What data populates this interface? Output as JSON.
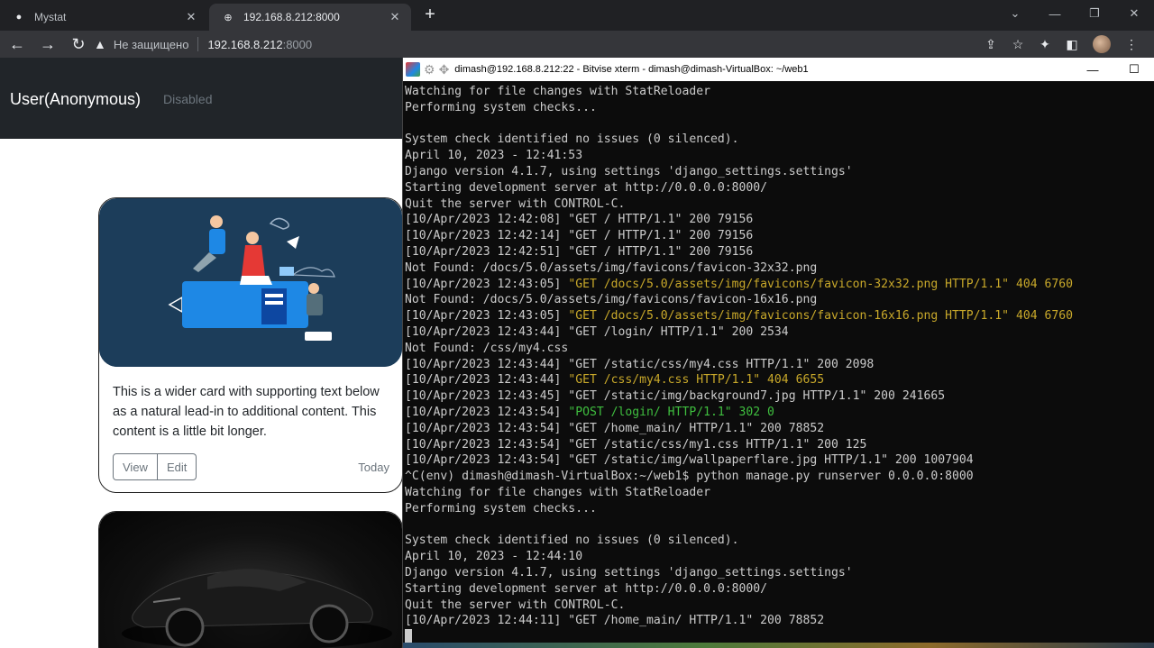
{
  "browser": {
    "tabs": [
      {
        "title": "Mystat",
        "active": false
      },
      {
        "title": "192.168.8.212:8000",
        "active": true
      }
    ],
    "address": {
      "security_label": "Не защищено",
      "host": "192.168.8.212",
      "port": ":8000"
    }
  },
  "page": {
    "brand": "User(Anonymous)",
    "nav_disabled": "Disabled",
    "cards": [
      {
        "text": "This is a wider card with supporting text below as a natural lead-in to additional content. This content is a little bit longer.",
        "buttons": [
          "View",
          "Edit"
        ],
        "meta": "Today"
      }
    ]
  },
  "terminal": {
    "title": "dimash@192.168.8.212:22 - Bitvise xterm - dimash@dimash-VirtualBox: ~/web1",
    "lines": [
      {
        "t": "Watching for file changes with StatReloader"
      },
      {
        "t": "Performing system checks..."
      },
      {
        "t": ""
      },
      {
        "t": "System check identified no issues (0 silenced)."
      },
      {
        "t": "April 10, 2023 - 12:41:53"
      },
      {
        "t": "Django version 4.1.7, using settings 'django_settings.settings'"
      },
      {
        "t": "Starting development server at http://0.0.0.0:8000/"
      },
      {
        "t": "Quit the server with CONTROL-C."
      },
      {
        "t": "[10/Apr/2023 12:42:08] \"GET / HTTP/1.1\" 200 79156"
      },
      {
        "t": "[10/Apr/2023 12:42:14] \"GET / HTTP/1.1\" 200 79156"
      },
      {
        "t": "[10/Apr/2023 12:42:51] \"GET / HTTP/1.1\" 200 79156"
      },
      {
        "t": "Not Found: /docs/5.0/assets/img/favicons/favicon-32x32.png"
      },
      {
        "p": "[10/Apr/2023 12:43:05] ",
        "t": "\"GET /docs/5.0/assets/img/favicons/favicon-32x32.png HTTP/1.1\" 404 6760",
        "c": "y"
      },
      {
        "t": "Not Found: /docs/5.0/assets/img/favicons/favicon-16x16.png"
      },
      {
        "p": "[10/Apr/2023 12:43:05] ",
        "t": "\"GET /docs/5.0/assets/img/favicons/favicon-16x16.png HTTP/1.1\" 404 6760",
        "c": "y"
      },
      {
        "t": "[10/Apr/2023 12:43:44] \"GET /login/ HTTP/1.1\" 200 2534"
      },
      {
        "t": "Not Found: /css/my4.css"
      },
      {
        "t": "[10/Apr/2023 12:43:44] \"GET /static/css/my4.css HTTP/1.1\" 200 2098"
      },
      {
        "p": "[10/Apr/2023 12:43:44] ",
        "t": "\"GET /css/my4.css HTTP/1.1\" 404 6655",
        "c": "y"
      },
      {
        "t": "[10/Apr/2023 12:43:45] \"GET /static/img/background7.jpg HTTP/1.1\" 200 241665"
      },
      {
        "p": "[10/Apr/2023 12:43:54] ",
        "t": "\"POST /login/ HTTP/1.1\" 302 0",
        "c": "g"
      },
      {
        "t": "[10/Apr/2023 12:43:54] \"GET /home_main/ HTTP/1.1\" 200 78852"
      },
      {
        "t": "[10/Apr/2023 12:43:54] \"GET /static/css/my1.css HTTP/1.1\" 200 125"
      },
      {
        "t": "[10/Apr/2023 12:43:54] \"GET /static/img/wallpaperflare.jpg HTTP/1.1\" 200 1007904"
      },
      {
        "t": "^C(env) dimash@dimash-VirtualBox:~/web1$ python manage.py runserver 0.0.0.0:8000"
      },
      {
        "t": "Watching for file changes with StatReloader"
      },
      {
        "t": "Performing system checks..."
      },
      {
        "t": ""
      },
      {
        "t": "System check identified no issues (0 silenced)."
      },
      {
        "t": "April 10, 2023 - 12:44:10"
      },
      {
        "t": "Django version 4.1.7, using settings 'django_settings.settings'"
      },
      {
        "t": "Starting development server at http://0.0.0.0:8000/"
      },
      {
        "t": "Quit the server with CONTROL-C."
      },
      {
        "t": "[10/Apr/2023 12:44:11] \"GET /home_main/ HTTP/1.1\" 200 78852"
      }
    ]
  }
}
